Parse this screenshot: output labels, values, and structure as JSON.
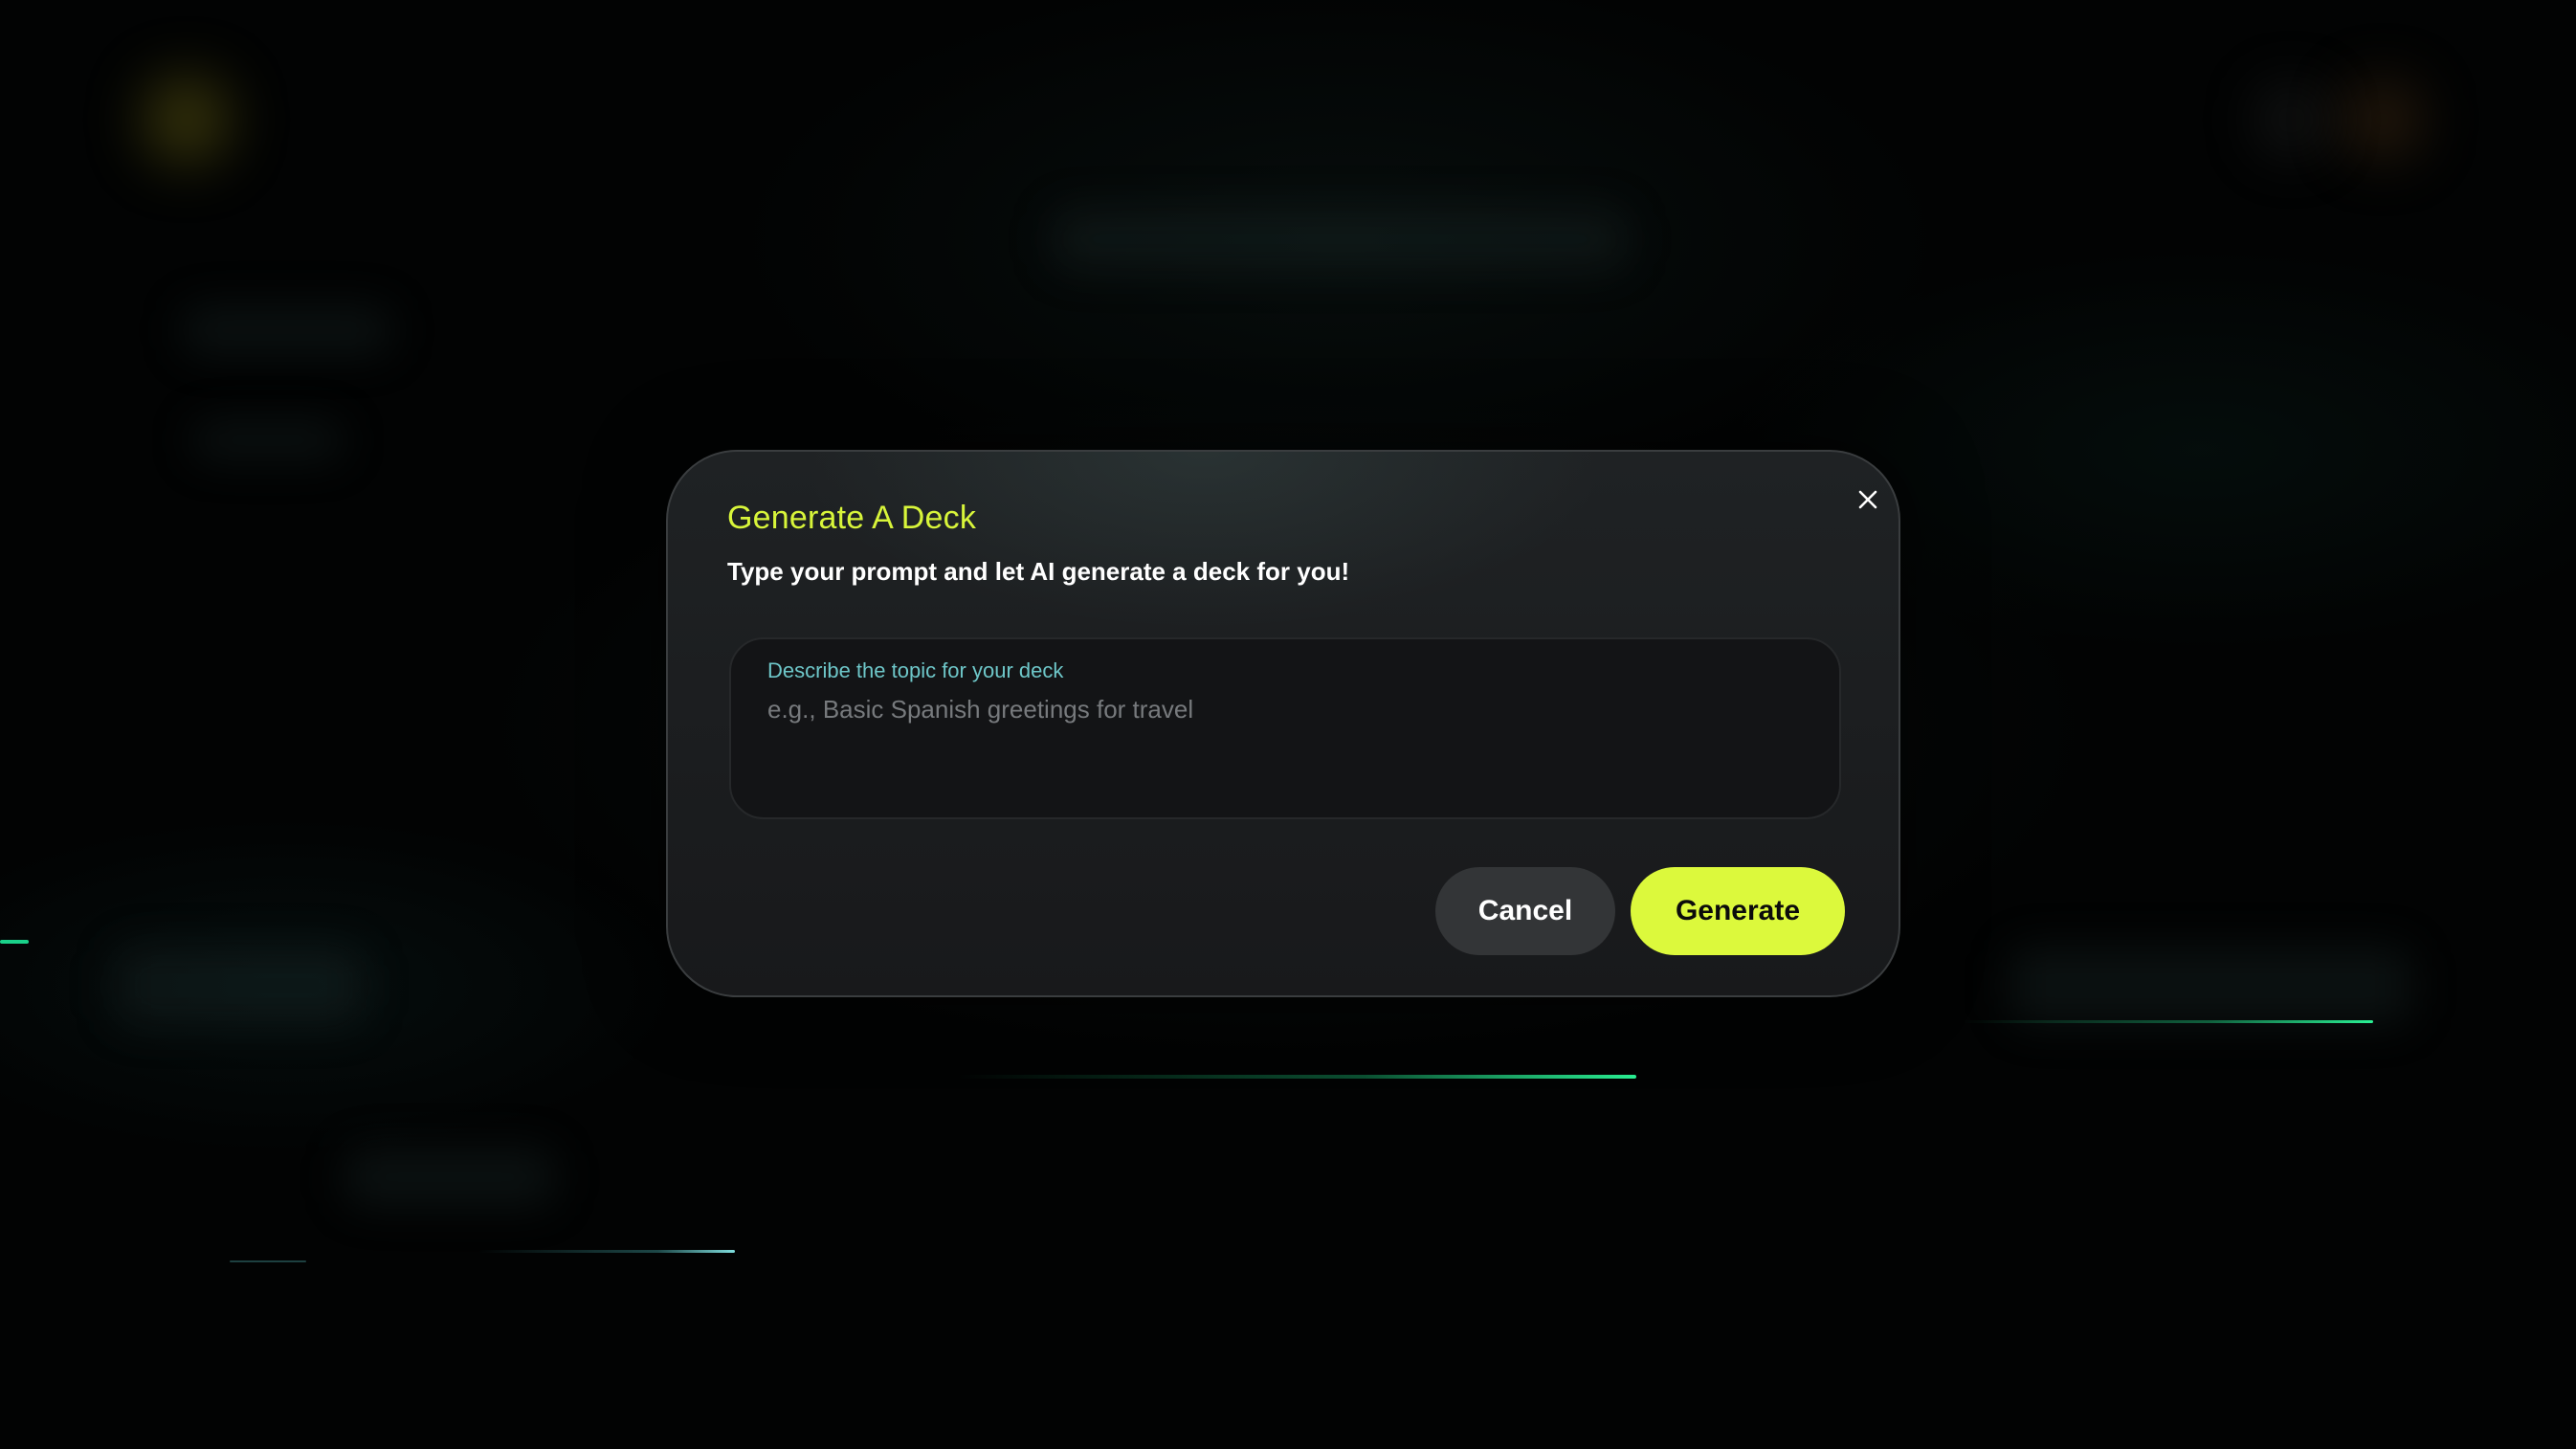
{
  "modal": {
    "title": "Generate A Deck",
    "subtitle": "Type your prompt and let AI generate a deck for you!",
    "close_icon": "close-icon",
    "field": {
      "label": "Describe the topic for your deck",
      "placeholder": "e.g., Basic Spanish greetings for travel",
      "value": ""
    },
    "buttons": {
      "cancel_label": "Cancel",
      "generate_label": "Generate"
    }
  },
  "colors": {
    "accent": "#dcf93c",
    "title": "#d8f53a",
    "label": "#6ec7c9",
    "streak": "#1fe08a"
  }
}
